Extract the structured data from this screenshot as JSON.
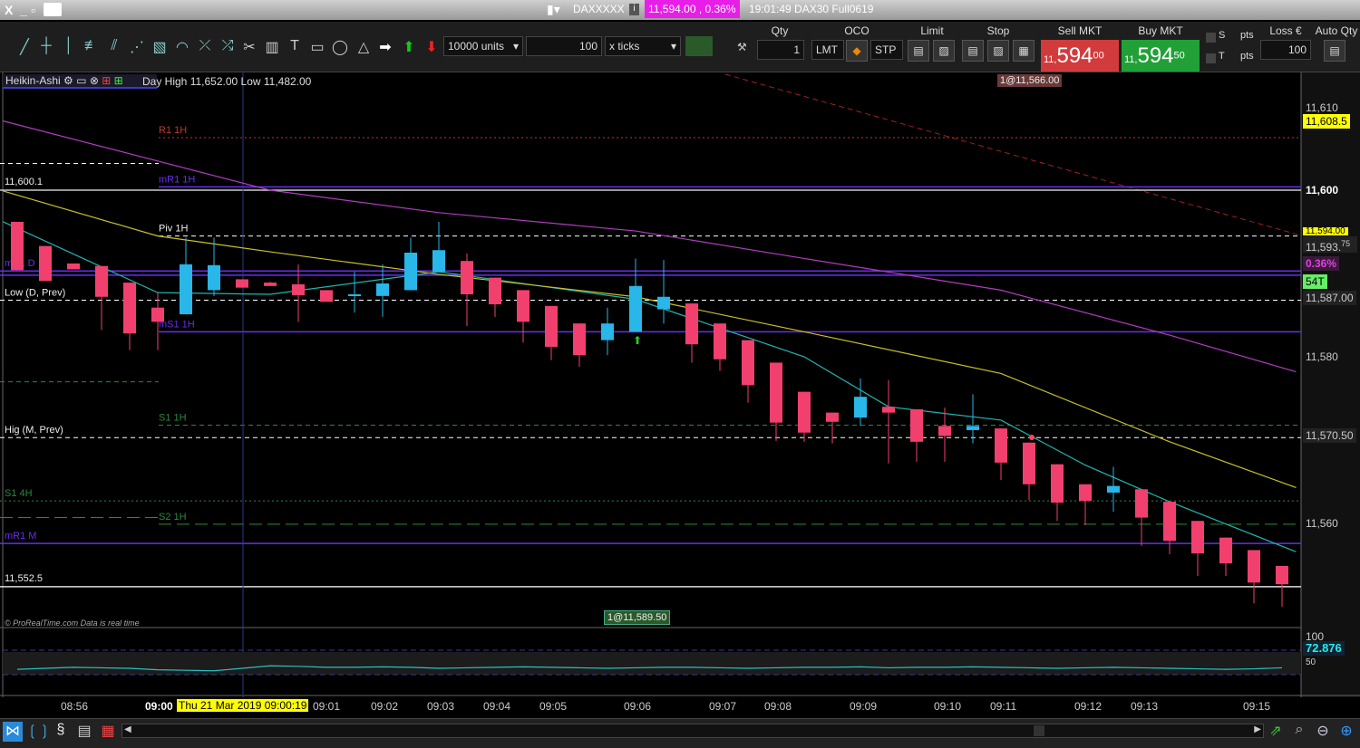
{
  "window": {
    "close": "X",
    "minimize": "_",
    "restore": "▫",
    "keyboard_icon": "keyboard-icon"
  },
  "instrument": {
    "name": "DAXXXXX",
    "price_badge": "11,594.00 , 0.36%",
    "info": "19:01:49 DAX30 Full0619"
  },
  "toolbar": {
    "units_select": "10000 units",
    "value_input": "100",
    "ticks_select": "x ticks"
  },
  "order": {
    "qty_header": "Qty",
    "qty_value": "1",
    "oco_header": "OCO",
    "lmt": "LMT",
    "stp": "STP",
    "limit_header": "Limit",
    "stop_header": "Stop",
    "sell_header": "Sell MKT",
    "buy_header": "Buy MKT",
    "sell_prefix": "11,",
    "sell_big": "594",
    "sell_dec": "00",
    "buy_prefix": "11,",
    "buy_big": "594",
    "buy_dec": "50",
    "s_label": "S",
    "t_label": "T",
    "pts1": "pts",
    "pts2": "pts",
    "loss_header": "Loss €",
    "loss_value": "100",
    "auto_qty_header": "Auto Qty"
  },
  "chart_header": {
    "type": "Heikin-Ashi",
    "day_info": "Day High 11,652.00 Low 11,482.00"
  },
  "annotations": {
    "sell_order": "1@11,566.00",
    "buy_order": "1@11,589.50",
    "copyright": "© ProRealTime.com  Data is real time"
  },
  "right_axis": {
    "ticks": [
      "11,610",
      "11,600",
      "11,580",
      "11,560"
    ],
    "high_marker": "11,608.5",
    "ask_marker": "11,594.00",
    "last_price": "11,593.",
    "last_price_dec": "75",
    "change": "0.36%",
    "ticks_count": "54T",
    "level_1": "11,587.00",
    "level_2": "11,570.50"
  },
  "osc_axis": {
    "top": "100",
    "value": "72.876",
    "mid": "50"
  },
  "time_axis": {
    "labels": [
      "08:56",
      "09:00",
      "09:01",
      "09:02",
      "09:03",
      "09:04",
      "09:05",
      "09:06",
      "09:07",
      "09:08",
      "09:09",
      "09:10",
      "09:11",
      "09:12",
      "09:13",
      "09:15"
    ],
    "cursor": "Thu 21 Mar 2019 09:00:19"
  },
  "levels": [
    {
      "label": "R1 1H",
      "price": 11606.3,
      "color": "#c0392b",
      "style": "dotted",
      "from": 5
    },
    {
      "label": "mR1 1H",
      "price": 11600.4,
      "color": "#6a2cf0",
      "style": "solid",
      "from": 5
    },
    {
      "label": "11,600.1",
      "price": 11600.0,
      "color": "#ccc",
      "style": "solid",
      "from": 0
    },
    {
      "label": "",
      "price": 11603.2,
      "color": "#fff",
      "style": "dashed",
      "from": 0,
      "to": 5
    },
    {
      "label": "Piv 1H",
      "price": 11594.5,
      "color": "#fff",
      "style": "dashed",
      "from": 5
    },
    {
      "label": "mS1 D",
      "price": 11590.3,
      "color": "#6a2cf0",
      "style": "solid",
      "from": 0
    },
    {
      "label": "",
      "price": 11589.8,
      "color": "#6a2cf0",
      "style": "solid",
      "from": 0
    },
    {
      "label": "Low (D, Prev)",
      "price": 11586.8,
      "color": "#fff",
      "style": "dashed",
      "from": 0
    },
    {
      "label": "mS1 1H",
      "price": 11583.0,
      "color": "#6a2cf0",
      "style": "solid",
      "from": 5
    },
    {
      "label": "",
      "price": 11577.0,
      "color": "#2a8a3a",
      "style": "dashed",
      "from": 0,
      "to": 5
    },
    {
      "label": "S1 1H",
      "price": 11571.8,
      "color": "#2a8a3a",
      "style": "dashed",
      "from": 5
    },
    {
      "label": "Hig (M, Prev)",
      "price": 11570.3,
      "color": "#fff",
      "style": "dashed",
      "from": 0
    },
    {
      "label": "S1 4H",
      "price": 11562.7,
      "color": "#2a8a3a",
      "style": "dotted",
      "from": 0
    },
    {
      "label": "",
      "price": 11560.7,
      "color": "#2a8a3a",
      "style": "longdash",
      "from": 0,
      "to": 5
    },
    {
      "label": "S2 1H",
      "price": 11559.9,
      "color": "#2a8a3a",
      "style": "longdash",
      "from": 5
    },
    {
      "label": "mR1 M",
      "price": 11557.6,
      "color": "#6a2cf0",
      "style": "solid",
      "from": 0
    },
    {
      "label": "11,552.5",
      "price": 11552.4,
      "color": "#ddd",
      "style": "solid",
      "from": 0
    }
  ],
  "chart_data": {
    "type": "candlestick",
    "style": "Heikin-Ashi",
    "colors": {
      "up": "#29b6e8",
      "down": "#f2406e"
    },
    "candles": [
      [
        11596.2,
        11596.2,
        11590.4,
        11590.4
      ],
      [
        11593.3,
        11593.3,
        11589.1,
        11589.1
      ],
      [
        11591.2,
        11591.2,
        11590.5,
        11590.5
      ],
      [
        11590.9,
        11590.9,
        11583.2,
        11587.2
      ],
      [
        11588.9,
        11588.9,
        11580.8,
        11582.8
      ],
      [
        11585.9,
        11587.7,
        11580.8,
        11584.2
      ],
      [
        11585.1,
        11594.3,
        11585.1,
        11591.1
      ],
      [
        11588.0,
        11594.3,
        11587.3,
        11591.0
      ],
      [
        11589.3,
        11589.3,
        11588.3,
        11588.3
      ],
      [
        11588.9,
        11589.0,
        11588.5,
        11588.5
      ],
      [
        11588.7,
        11591.1,
        11584.2,
        11587.4
      ],
      [
        11588.0,
        11588.0,
        11586.6,
        11586.6
      ],
      [
        11587.3,
        11590.2,
        11585.3,
        11587.5
      ],
      [
        11587.3,
        11591.1,
        11584.8,
        11588.8
      ],
      [
        11588.0,
        11594.3,
        11588.0,
        11592.5
      ],
      [
        11590.2,
        11596.2,
        11590.2,
        11592.8
      ],
      [
        11591.5,
        11592.4,
        11583.7,
        11587.5
      ],
      [
        11589.5,
        11589.5,
        11584.8,
        11586.3
      ],
      [
        11588.0,
        11588.0,
        11581.7,
        11584.2
      ],
      [
        11586.1,
        11586.1,
        11579.6,
        11581.2
      ],
      [
        11584.0,
        11584.0,
        11578.8,
        11580.2
      ],
      [
        11582.0,
        11585.9,
        11580.2,
        11584.0
      ],
      [
        11583.0,
        11591.8,
        11583.0,
        11588.5
      ],
      [
        11585.7,
        11591.6,
        11584.0,
        11587.2
      ],
      [
        11586.4,
        11586.4,
        11579.3,
        11581.5
      ],
      [
        11584.0,
        11584.0,
        11578.3,
        11579.7
      ],
      [
        11582.0,
        11582.0,
        11574.5,
        11576.6
      ],
      [
        11579.3,
        11579.3,
        11569.9,
        11572.1
      ],
      [
        11575.8,
        11575.8,
        11569.8,
        11570.9
      ],
      [
        11573.3,
        11573.3,
        11569.6,
        11572.2
      ],
      [
        11572.7,
        11577.4,
        11571.7,
        11575.2
      ],
      [
        11574.0,
        11577.2,
        11567.2,
        11573.3
      ],
      [
        11573.7,
        11573.7,
        11567.4,
        11569.8
      ],
      [
        11571.7,
        11573.9,
        11567.4,
        11570.5
      ],
      [
        11571.2,
        11575.5,
        11569.6,
        11571.7
      ],
      [
        11571.4,
        11571.4,
        11565.2,
        11567.3
      ],
      [
        11569.7,
        11569.7,
        11562.8,
        11564.7
      ],
      [
        11567.1,
        11567.1,
        11560.3,
        11562.5
      ],
      [
        11564.7,
        11564.7,
        11559.8,
        11562.7
      ],
      [
        11563.7,
        11566.8,
        11561.4,
        11564.5
      ],
      [
        11564.1,
        11564.1,
        11557.3,
        11560.7
      ],
      [
        11562.6,
        11562.6,
        11556.3,
        11557.9
      ],
      [
        11560.3,
        11560.3,
        11553.7,
        11556.4
      ],
      [
        11558.3,
        11558.3,
        11553.7,
        11555.2
      ],
      [
        11556.8,
        11556.8,
        11550.4,
        11552.9
      ],
      [
        11554.9,
        11554.9,
        11550.0,
        11552.7
      ]
    ],
    "candle_format": [
      "open",
      "high",
      "low",
      "close"
    ],
    "moving_averages": [
      {
        "name": "fast",
        "color": "#1fb5b0",
        "points": [
          [
            -0.5,
            11596.2
          ],
          [
            5,
            11587.7
          ],
          [
            9,
            11587.5
          ],
          [
            15,
            11590.2
          ],
          [
            22,
            11586.9
          ],
          [
            28,
            11580.0
          ],
          [
            31,
            11574.0
          ],
          [
            35,
            11572.4
          ],
          [
            38,
            11567.0
          ],
          [
            41,
            11562.6
          ],
          [
            45.5,
            11556.6
          ]
        ]
      },
      {
        "name": "medium",
        "color": "#c9c22a",
        "points": [
          [
            -0.5,
            11599.9
          ],
          [
            5,
            11594.5
          ],
          [
            9,
            11592.6
          ],
          [
            15,
            11589.9
          ],
          [
            22,
            11587.2
          ],
          [
            28,
            11583.0
          ],
          [
            35,
            11578.0
          ],
          [
            41,
            11569.8
          ],
          [
            45.5,
            11564.3
          ]
        ]
      },
      {
        "name": "slow",
        "color": "#b03cc0",
        "points": [
          [
            -0.5,
            11608.3
          ],
          [
            9,
            11600.0
          ],
          [
            15,
            11597.3
          ],
          [
            22,
            11595.1
          ],
          [
            28,
            11591.8
          ],
          [
            35,
            11588.0
          ],
          [
            41,
            11582.6
          ],
          [
            45.5,
            11578.2
          ]
        ]
      }
    ],
    "oscillator": {
      "values": [
        38,
        40,
        42,
        41,
        40,
        37,
        36,
        35,
        40,
        45,
        44,
        42,
        42,
        43,
        42,
        40,
        41,
        42,
        43,
        42,
        41,
        40,
        41,
        42,
        42,
        41,
        40,
        41,
        42,
        42,
        43,
        41,
        42,
        42,
        43,
        42,
        41,
        40,
        41,
        42,
        41,
        40,
        39,
        38,
        39,
        41
      ],
      "range": [
        0,
        100
      ]
    },
    "yaxis_ticks": [
      11560,
      11580,
      11600,
      11610
    ]
  }
}
